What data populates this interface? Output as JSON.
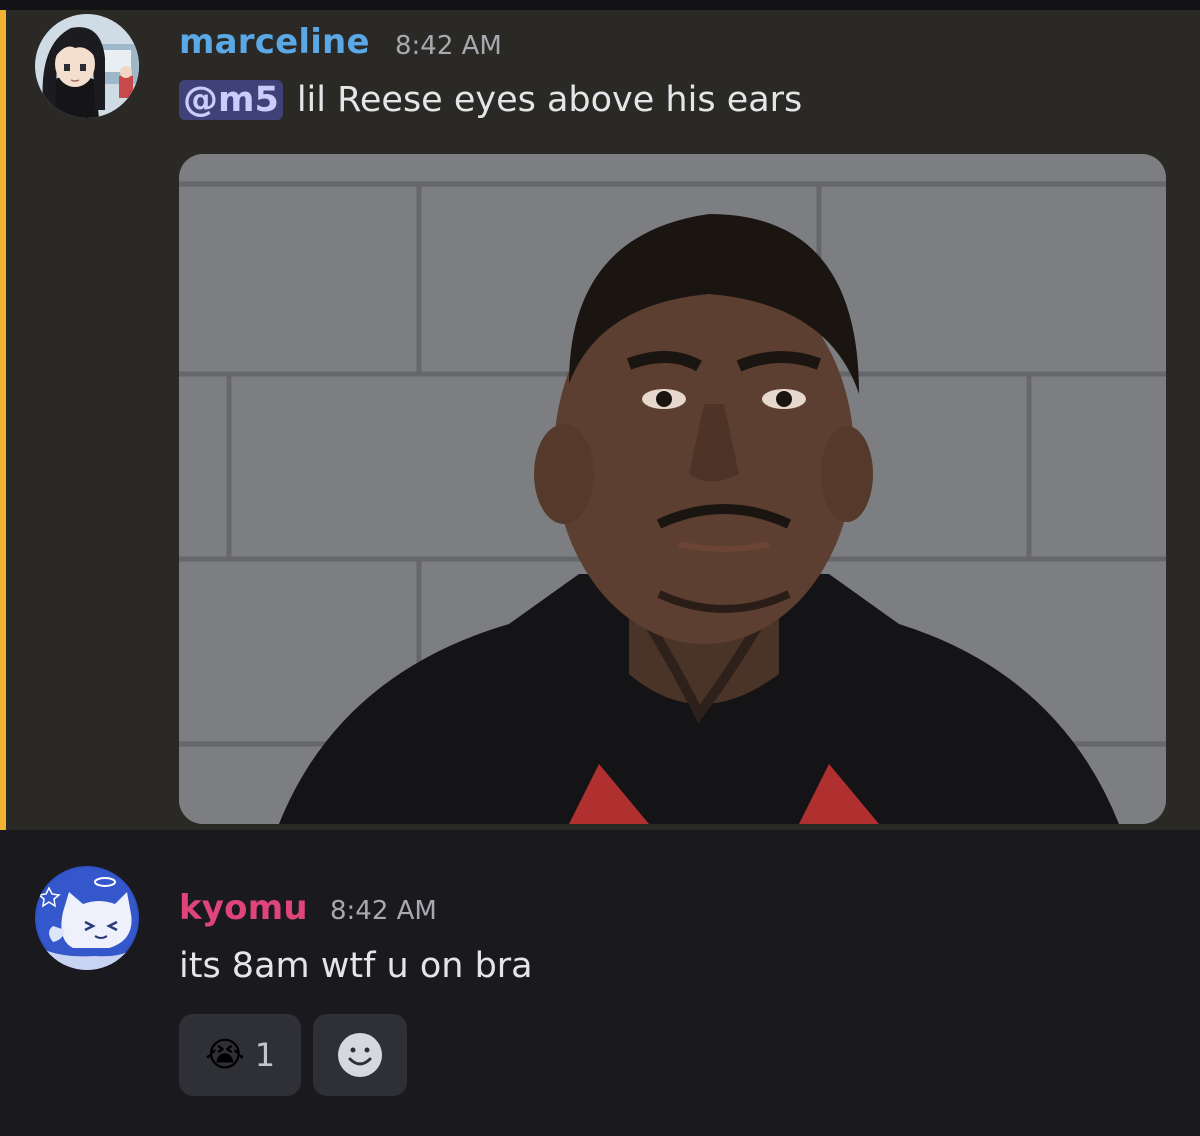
{
  "messages": [
    {
      "author": "marceline",
      "author_color": "#5aa8e6",
      "timestamp": "8:42 AM",
      "mention": "@m5",
      "text": "lil Reese eyes above his ears",
      "avatar_icon": "anime-girl-avatar",
      "attachment": "mugshot-photo",
      "highlighted": true
    },
    {
      "author": "kyomu",
      "author_color": "#e0457a",
      "timestamp": "8:42 AM",
      "text": "its 8am wtf u on bra",
      "avatar_icon": "cat-angel-avatar",
      "reactions": [
        {
          "emoji": "😭",
          "icon": "loudly-crying-face-icon",
          "count": "1"
        },
        {
          "icon": "add-reaction-icon"
        }
      ]
    }
  ],
  "colors": {
    "highlight_bar": "#f0b232",
    "highlight_bg": "#2b2925",
    "background": "#1a1a1e",
    "mention_bg": "#3e4278"
  }
}
